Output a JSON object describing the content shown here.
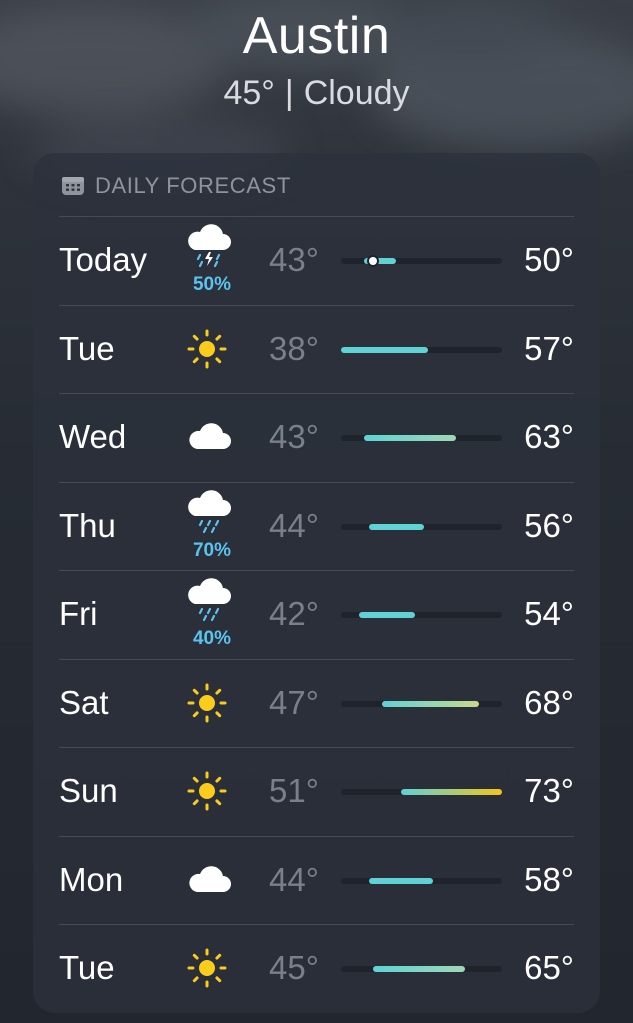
{
  "header": {
    "city": "Austin",
    "temp": "45°",
    "separator": "|",
    "condition": "Cloudy"
  },
  "forecast": {
    "title": "DAILY FORECAST",
    "title_icon": "calendar-icon",
    "scale_min": 38,
    "scale_max": 73,
    "current_temp": 45,
    "days": [
      {
        "day": "Today",
        "icon": "cloud-bolt-rain-icon",
        "pop": "50%",
        "low": "43°",
        "high": "50°",
        "lo": 43,
        "hi": 50,
        "show_now": true
      },
      {
        "day": "Tue",
        "icon": "sun-icon",
        "pop": "",
        "low": "38°",
        "high": "57°",
        "lo": 38,
        "hi": 57
      },
      {
        "day": "Wed",
        "icon": "cloud-icon",
        "pop": "",
        "low": "43°",
        "high": "63°",
        "lo": 43,
        "hi": 63
      },
      {
        "day": "Thu",
        "icon": "cloud-rain-icon",
        "pop": "70%",
        "low": "44°",
        "high": "56°",
        "lo": 44,
        "hi": 56
      },
      {
        "day": "Fri",
        "icon": "cloud-rain-icon",
        "pop": "40%",
        "low": "42°",
        "high": "54°",
        "lo": 42,
        "hi": 54
      },
      {
        "day": "Sat",
        "icon": "sun-icon",
        "pop": "",
        "low": "47°",
        "high": "68°",
        "lo": 47,
        "hi": 68
      },
      {
        "day": "Sun",
        "icon": "sun-icon",
        "pop": "",
        "low": "51°",
        "high": "73°",
        "lo": 51,
        "hi": 73
      },
      {
        "day": "Mon",
        "icon": "cloud-icon",
        "pop": "",
        "low": "44°",
        "high": "58°",
        "lo": 44,
        "hi": 58
      },
      {
        "day": "Tue",
        "icon": "sun-icon",
        "pop": "",
        "low": "45°",
        "high": "65°",
        "lo": 45,
        "hi": 65
      }
    ]
  },
  "colors": {
    "cool": "#5fd2d6",
    "mild": "#9fd7b7",
    "warm": "#f5c518",
    "precip": "#5bc3f0",
    "sun": "#fccc1a"
  }
}
